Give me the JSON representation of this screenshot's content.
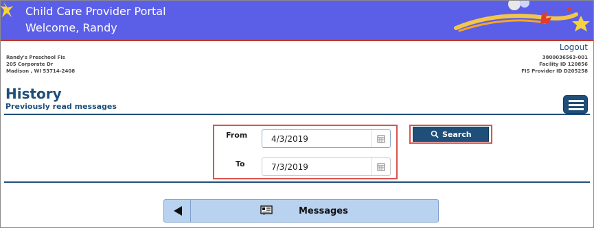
{
  "header": {
    "title": "Child Care Provider Portal",
    "welcome": "Welcome, Randy"
  },
  "provider": {
    "name": "Randy's Preschool Fis",
    "address1": "205 Corporate Dr",
    "address2": "Madison , WI 53714-2408",
    "id_number": "3800036563-001",
    "facility_id": "Facility ID 120856",
    "fis_provider_id": "FIS Provider ID D205258"
  },
  "nav": {
    "logout": "Logout"
  },
  "page": {
    "title": "History",
    "subtitle": "Previously read messages"
  },
  "filters": {
    "from_label": "From",
    "from_value": "4/3/2019",
    "to_label": "To",
    "to_value": "7/3/2019",
    "search_label": "Search"
  },
  "messages_nav": {
    "label": "Messages"
  },
  "colors": {
    "banner": "#5b5fe8",
    "accent": "#1f4e79",
    "highlight": "#d9534f",
    "nav_button": "#b8d2f0"
  }
}
